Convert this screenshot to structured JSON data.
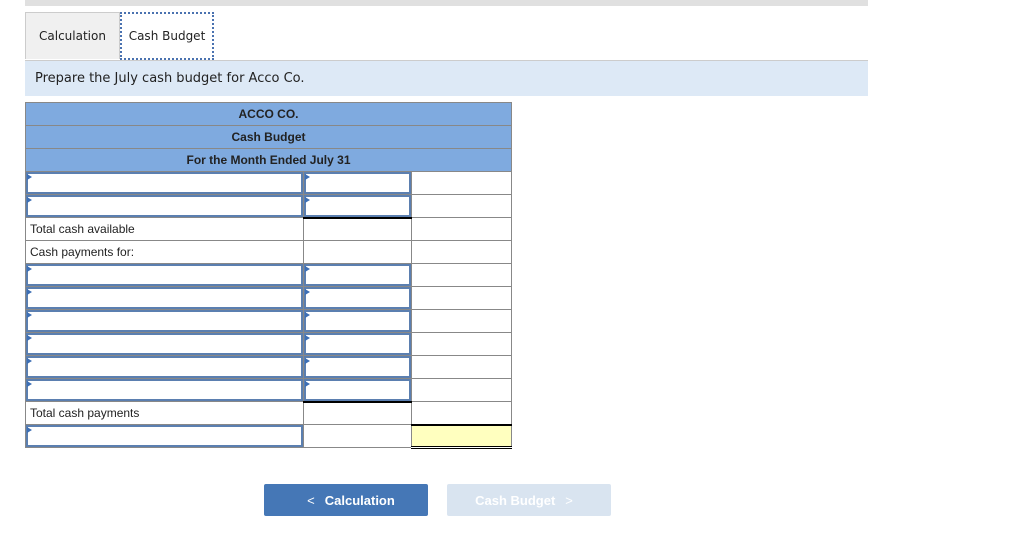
{
  "tabs": [
    {
      "label": "Calculation",
      "active": false
    },
    {
      "label": "Cash Budget",
      "active": true
    }
  ],
  "prompt": "Prepare the July cash budget for Acco Co.",
  "budget": {
    "company": "ACCO CO.",
    "title": "Cash Budget",
    "period": "For the Month Ended July 31",
    "labels": {
      "total_cash_available": "Total cash available",
      "cash_payments_for": "Cash payments for:",
      "total_cash_payments": "Total cash payments"
    }
  },
  "nav": {
    "prev_label": "Calculation",
    "next_label": "Cash Budget",
    "prev_icon": "chevron-left-icon",
    "next_icon": "chevron-right-icon"
  },
  "colors": {
    "header_bg": "#7faadf",
    "input_border": "#5b7fb0",
    "highlight": "#ffffbf",
    "primary_button": "#4577b6"
  }
}
